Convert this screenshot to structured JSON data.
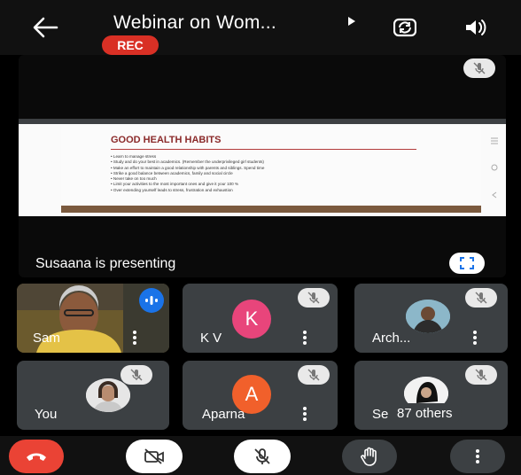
{
  "header": {
    "title": "Webinar on Wom...",
    "rec_label": "REC"
  },
  "presentation": {
    "slide_title": "GOOD HEALTH HABITS",
    "slide_points": [
      "Learn to manage stress",
      "Study and do your best in academics. (Remember the underprivileged girl students)",
      "Make an effort to maintain a good relationship with parents and siblings. Spend time",
      "Strike a good balance between academics, family and social circle",
      "Never take on too much",
      "Limit your activities to the most important ones and give it your 100 %",
      "Over extending yourself leads to stress, frustration and exhaustion"
    ],
    "presenting_label": "Susaana is presenting"
  },
  "participants": [
    {
      "name": "Sam",
      "type": "video"
    },
    {
      "name": "K V",
      "initial": "K",
      "color": "#e8457b"
    },
    {
      "name": "Arch...",
      "type": "photo"
    },
    {
      "name": "You",
      "type": "photo"
    },
    {
      "name": "Aparna",
      "initial": "A",
      "color": "#f1602b"
    },
    {
      "name": "Se",
      "others_label": "87 others",
      "type": "photo"
    }
  ],
  "colors": {
    "end_call": "#ea4335",
    "rec": "#d93025",
    "tile": "#3c4043",
    "active_speaker": "#1a73e8"
  },
  "icons": {
    "controls": [
      "end-call-icon",
      "camera-off-icon",
      "mic-off-icon",
      "raise-hand-icon",
      "more-options-icon"
    ]
  }
}
